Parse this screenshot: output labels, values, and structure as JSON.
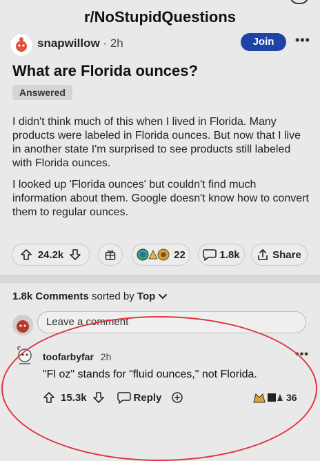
{
  "subreddit": "r/NoStupidQuestions",
  "post": {
    "username": "snapwillow",
    "time": "2h",
    "join_label": "Join",
    "more_label": "•••",
    "title": "What are Florida ounces?",
    "badge": "Answered",
    "body": [
      "I didn't think much of this when I lived in Florida. Many products were labeled in Florida ounces. But now that I live in another state I'm surprised to see products still labeled with Florida ounces.",
      "I looked up 'Florida ounces' but couldn't find much information about them. Google doesn't know how to convert them to regular ounces."
    ],
    "votes": "24.2k",
    "awards_count": "22",
    "comments_count": "1.8k",
    "share_label": "Share"
  },
  "comments_section": {
    "count": "1.8k Comments",
    "sorted_by_label": "sorted by",
    "sort": "Top",
    "placeholder": "Leave a comment"
  },
  "comment": {
    "username": "toofarbyfar",
    "time": "2h",
    "more_label": "•••",
    "text": "\"Fl oz\" stands for \"fluid ounces,\" not Florida.",
    "votes": "15.3k",
    "reply_label": "Reply",
    "awards_count": "36"
  },
  "colors": {
    "accent": "#1f44a8",
    "highlight_circle": "#e0353f",
    "background": "#e9e9e9"
  },
  "icons": [
    "close-icon",
    "upvote-icon",
    "downvote-icon",
    "award-icon",
    "comment-icon",
    "share-icon",
    "chevron-down-icon",
    "more-icon"
  ]
}
